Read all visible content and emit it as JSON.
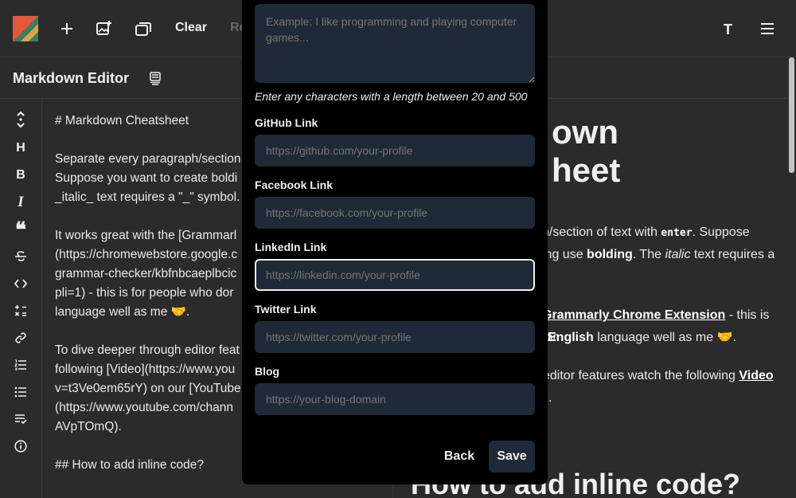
{
  "topbar": {
    "clear_label": "Clear",
    "reset_label": "Re",
    "theme_label": "T"
  },
  "header": {
    "title": "Markdown Editor"
  },
  "editor": {
    "lines": [
      "# Markdown Cheatsheet",
      "Separate every paragraph/section\nSuppose you want to create boldi\n_italic_ text requires a \"_\" symbol.",
      "It works great with the [Grammarl\n(https://chromewebstore.google.c\ngrammar-checker/kbfnbcaeplbcic\npli=1) - this is for people who dor\nlanguage well as me 🤝.",
      "To dive deeper through editor feat\nfollowing [Video](https://www.you\nv=t3Ve0em65rY) on our [YouTube\n(https://www.youtube.com/chann\nAVpTOmQ).",
      "## How to add inline code?"
    ]
  },
  "preview": {
    "h1_line1": "own",
    "h1_line2": "heet",
    "p1_a": "h/section of text with ",
    "p1_code": "enter",
    "p1_b": ". Suppose",
    "p1_c": "ing use ",
    "p1_bold": "bolding",
    "p1_d": ". The ",
    "p1_italic": "italic",
    "p1_e": " text requires a",
    "p2_link": "Grammarly Chrome Extension",
    "p2_a": " - this is for",
    "p2_bold": "English",
    "p2_b": " language well as me 🤝.",
    "p3_a": "editor features watch the following ",
    "p3_link": "Video",
    "p3_b": ".",
    "h2": "How to add inline code?"
  },
  "modal": {
    "about_placeholder": "Example: I like programming and playing computer games...",
    "about_hint": "Enter any characters with a length between 20 and 500",
    "fields": [
      {
        "label": "GitHub Link",
        "placeholder": "https://github.com/your-profile"
      },
      {
        "label": "Facebook Link",
        "placeholder": "https://facebook.com/your-profile"
      },
      {
        "label": "LinkedIn Link",
        "placeholder": "https://linkedin.com/your-profile"
      },
      {
        "label": "Twitter Link",
        "placeholder": "https://twitter.com/your-profile"
      },
      {
        "label": "Blog",
        "placeholder": "https://your-blog-domain"
      }
    ],
    "back_label": "Back",
    "save_label": "Save"
  }
}
